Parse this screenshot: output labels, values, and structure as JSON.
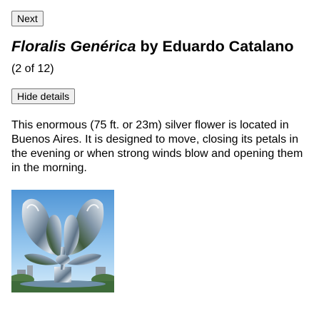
{
  "nav": {
    "next_label": "Next"
  },
  "artwork": {
    "title_italic": "Floralis Genérica",
    "title_rest": " by Eduardo Catalano",
    "counter": "(2 of 12)",
    "toggle_label": "Hide details",
    "description": "This enormous (75 ft. or 23m) silver flower is located in Buenos Aires. It is designed to move, closing its petals in the evening or when strong winds blow and opening them in the morning."
  },
  "image": {
    "icon": "flower-sculpture-photo",
    "sky_color": "#7db8e6",
    "metal_color": "#c9d3dc",
    "grass_color": "#3e6b3a"
  }
}
